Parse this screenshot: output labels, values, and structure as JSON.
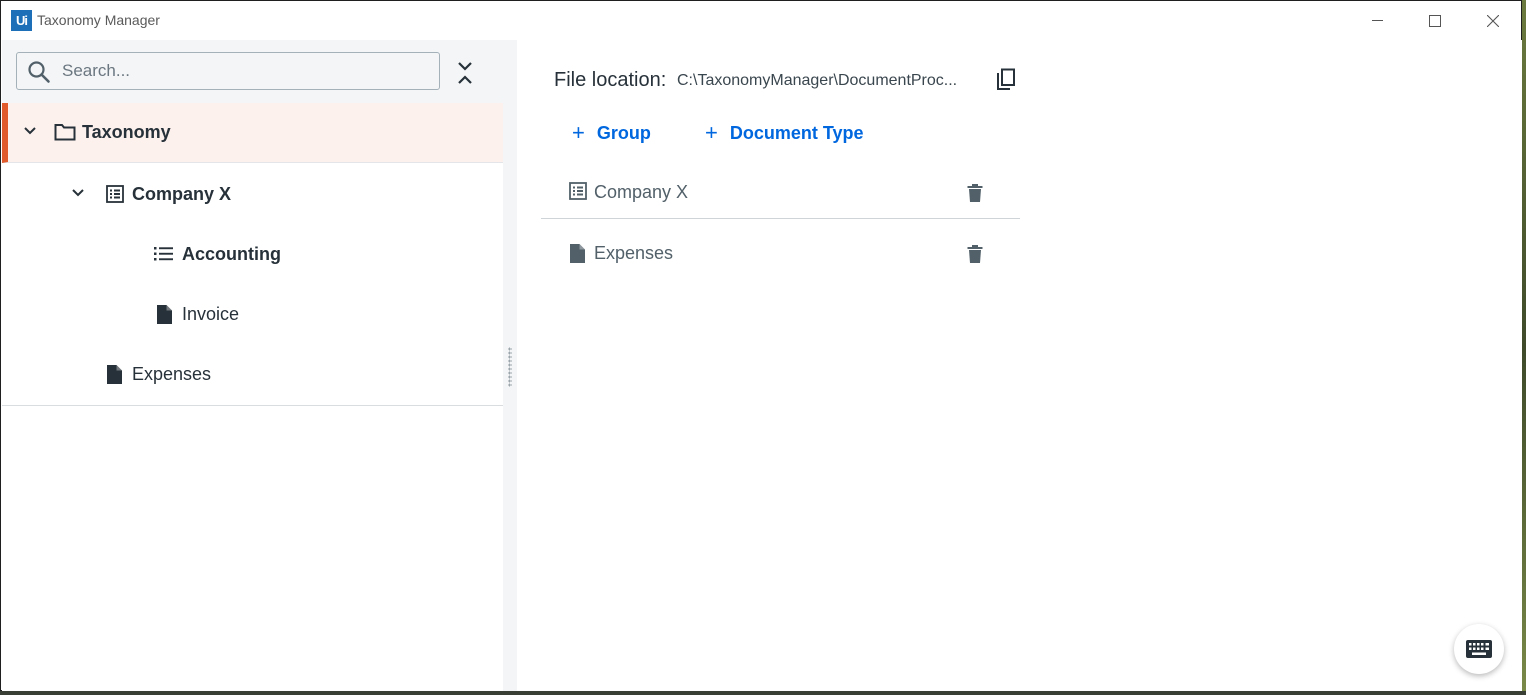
{
  "window": {
    "title": "Taxonomy Manager",
    "logo_text": "Ui"
  },
  "search": {
    "placeholder": "Search..."
  },
  "tree": {
    "root": {
      "label": "Taxonomy",
      "icon": "folder-icon"
    },
    "items": [
      {
        "label": "Company X",
        "icon": "group-list-icon"
      },
      {
        "label": "Accounting",
        "icon": "category-list-icon"
      },
      {
        "label": "Invoice",
        "icon": "document-icon"
      },
      {
        "label": "Expenses",
        "icon": "document-icon"
      }
    ]
  },
  "details": {
    "file_location_label": "File location:",
    "file_location_path": "C:\\TaxonomyManager\\DocumentProc...",
    "add_group_label": "Group",
    "add_document_type_label": "Document Type",
    "rows": [
      {
        "label": "Company X",
        "icon": "group-list-icon"
      },
      {
        "label": "Expenses",
        "icon": "document-icon"
      }
    ]
  },
  "colors": {
    "accent": "#0067df",
    "selection_bar": "#e05a2b",
    "selection_bg": "#fdf1ed",
    "logo_bg": "#1d6fb8"
  }
}
